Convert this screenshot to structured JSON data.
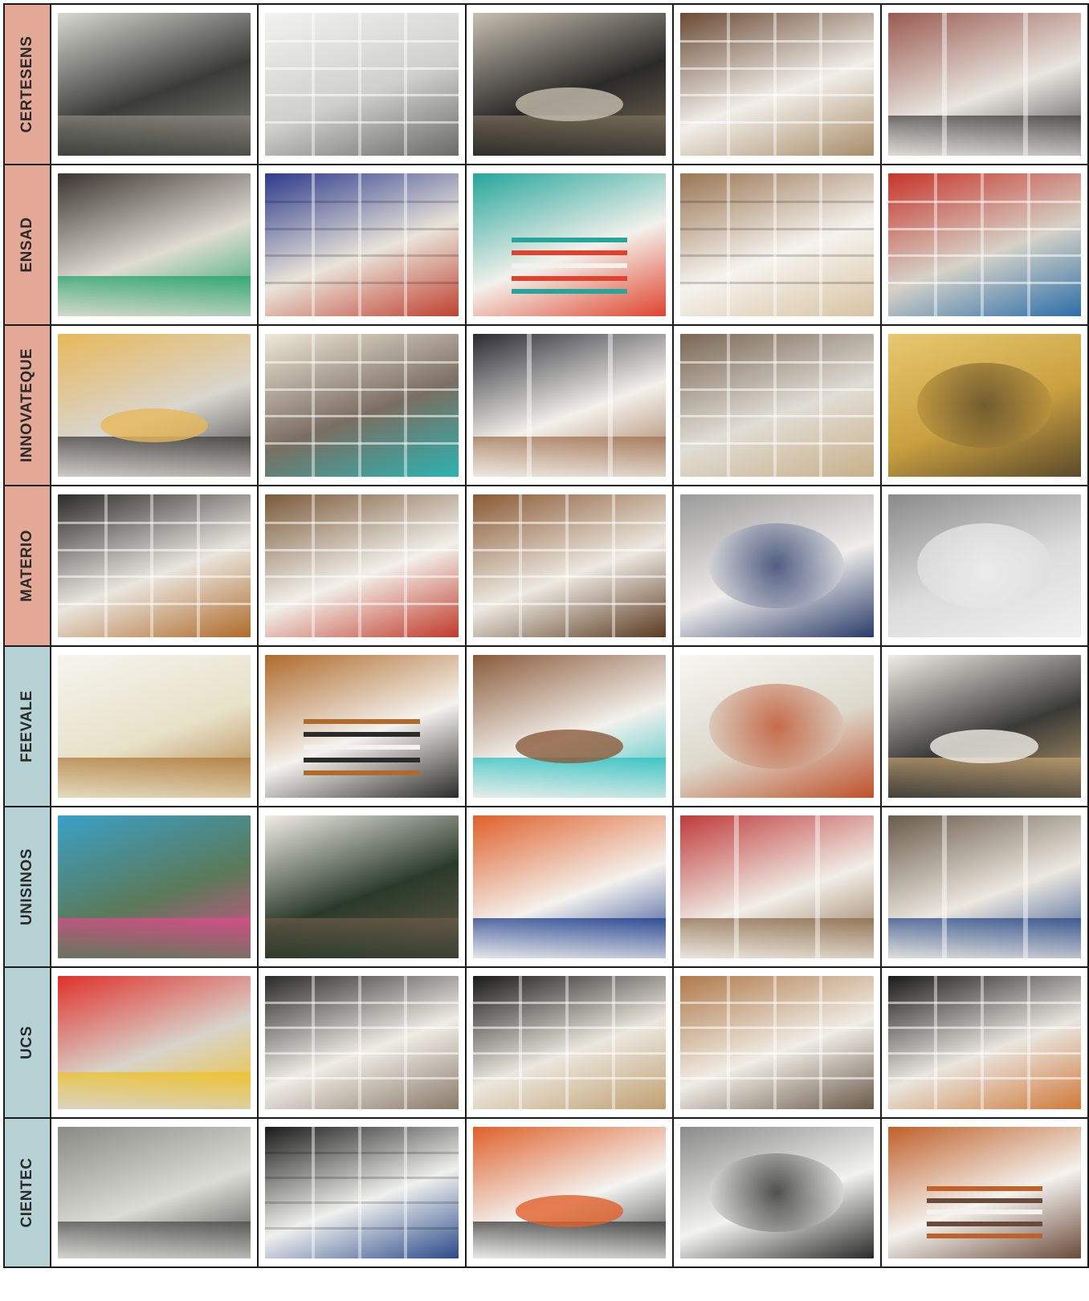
{
  "colors": {
    "salmon": "#e3a896",
    "teal": "#b7d2d4",
    "border": "#1a1a1a"
  },
  "rows": [
    {
      "label": "CERTESENS",
      "band": "salmon",
      "photos": [
        {
          "name": "reading-room",
          "tones": [
            "#3b3b38",
            "#d8d8d2",
            "#8a8a80"
          ],
          "style": "room"
        },
        {
          "name": "wire-shelves",
          "tones": [
            "#cfcfcb",
            "#f2f2ee",
            "#6a6a66"
          ],
          "style": "shelves"
        },
        {
          "name": "sample-table",
          "tones": [
            "#2a2a28",
            "#c7bfb0",
            "#7d6f5d"
          ],
          "style": "table"
        },
        {
          "name": "leather-shelves",
          "tones": [
            "#f1efea",
            "#6b4a34",
            "#a88c6a"
          ],
          "style": "shelves"
        },
        {
          "name": "library-aisle",
          "tones": [
            "#e8e6e0",
            "#9a5a50",
            "#444"
          ],
          "style": "aisle"
        }
      ]
    },
    {
      "label": "ENSAD",
      "band": "salmon",
      "photos": [
        {
          "name": "workroom",
          "tones": [
            "#e0dcd2",
            "#3a3430",
            "#1fa26a"
          ],
          "style": "room"
        },
        {
          "name": "fabric-rack",
          "tones": [
            "#e9e4da",
            "#2d3a8c",
            "#c04030"
          ],
          "style": "rack"
        },
        {
          "name": "color-plates",
          "tones": [
            "#f3f1ec",
            "#26a69a",
            "#e0432d"
          ],
          "style": "stack"
        },
        {
          "name": "leather-samples",
          "tones": [
            "#f5f3ef",
            "#9a7654",
            "#d8c3a3"
          ],
          "style": "rack"
        },
        {
          "name": "yarn-shelves",
          "tones": [
            "#d6d2c8",
            "#c7352b",
            "#2b6ea8"
          ],
          "style": "shelves"
        }
      ]
    },
    {
      "label": "INNOVATEQUE",
      "band": "salmon",
      "photos": [
        {
          "name": "meeting-table",
          "tones": [
            "#d9d6cf",
            "#e7b85a",
            "#3c3c3c"
          ],
          "style": "table"
        },
        {
          "name": "library-wall",
          "tones": [
            "#7a6e62",
            "#efe7d8",
            "#2bb3b1"
          ],
          "style": "shelves"
        },
        {
          "name": "composite-aisle",
          "tones": [
            "#f3f1ec",
            "#2a2a32",
            "#a07050"
          ],
          "style": "aisle"
        },
        {
          "name": "sample-cabinet",
          "tones": [
            "#e0ddd5",
            "#7a6755",
            "#c8b08a"
          ],
          "style": "shelves"
        },
        {
          "name": "foam-sample",
          "tones": [
            "#caa040",
            "#e7c870",
            "#5b4a2a"
          ],
          "style": "object"
        }
      ]
    },
    {
      "label": "MATERIO",
      "band": "salmon",
      "photos": [
        {
          "name": "visitor-shelves",
          "tones": [
            "#e9e6df",
            "#2b2b2b",
            "#b06a2a"
          ],
          "style": "shelves"
        },
        {
          "name": "binder-shelf",
          "tones": [
            "#f2f0eb",
            "#7a5a3a",
            "#c03a2a"
          ],
          "style": "shelves"
        },
        {
          "name": "wood-samples",
          "tones": [
            "#ede9e2",
            "#8a5a34",
            "#5a3a20"
          ],
          "style": "shelves"
        },
        {
          "name": "metal-mesh",
          "tones": [
            "#efedea",
            "#9a9a9a",
            "#2b3b6a"
          ],
          "style": "object"
        },
        {
          "name": "metal-pillow",
          "tones": [
            "#dcdcdc",
            "#8a8a8a",
            "#f0f0f0"
          ],
          "style": "object"
        }
      ]
    },
    {
      "label": "FEEVALE",
      "band": "teal",
      "photos": [
        {
          "name": "display-room",
          "tones": [
            "#e7e1c8",
            "#f6f4ef",
            "#b07a3a"
          ],
          "style": "room"
        },
        {
          "name": "open-drawers",
          "tones": [
            "#f4f2ee",
            "#b06a2a",
            "#2b2b2b"
          ],
          "style": "stack"
        },
        {
          "name": "display-tray",
          "tones": [
            "#f3f1ed",
            "#8a5a3a",
            "#2bc0c0"
          ],
          "style": "table"
        },
        {
          "name": "display-unit",
          "tones": [
            "#dcd8cc",
            "#f8f6f2",
            "#c0502a"
          ],
          "style": "object"
        },
        {
          "name": "photo-table",
          "tones": [
            "#3a3a38",
            "#f0ede6",
            "#c0a070"
          ],
          "style": "table"
        }
      ]
    },
    {
      "label": "UNISINOS",
      "band": "teal",
      "photos": [
        {
          "name": "container-exterior",
          "tones": [
            "#5a7a5a",
            "#3aa0c8",
            "#e04a8a"
          ],
          "style": "room"
        },
        {
          "name": "container-event",
          "tones": [
            "#2a3a2a",
            "#f0ede6",
            "#6a5a4a"
          ],
          "style": "room"
        },
        {
          "name": "reception-desk",
          "tones": [
            "#f4f2ee",
            "#e0602a",
            "#1a3a8a"
          ],
          "style": "room"
        },
        {
          "name": "sample-corridor",
          "tones": [
            "#f1eee8",
            "#c03a3a",
            "#8a6a4a"
          ],
          "style": "aisle"
        },
        {
          "name": "visitors-corridor",
          "tones": [
            "#ece8e0",
            "#6a5a4a",
            "#2a4a8a"
          ],
          "style": "aisle"
        }
      ]
    },
    {
      "label": "UCS",
      "band": "teal",
      "photos": [
        {
          "name": "glass-entrance",
          "tones": [
            "#d8d4cc",
            "#e0302a",
            "#f0c020"
          ],
          "style": "room"
        },
        {
          "name": "panel-displays",
          "tones": [
            "#efece6",
            "#2a2a2a",
            "#8a7a6a"
          ],
          "style": "shelves"
        },
        {
          "name": "grid-panels",
          "tones": [
            "#ebe7df",
            "#1a1a1a",
            "#c0a070"
          ],
          "style": "shelves"
        },
        {
          "name": "cubby-shelves",
          "tones": [
            "#f0ede6",
            "#b07a4a",
            "#6a5a4a"
          ],
          "style": "shelves"
        },
        {
          "name": "sample-grid",
          "tones": [
            "#e9e6e0",
            "#1a1a1a",
            "#d07a3a"
          ],
          "style": "shelves"
        }
      ]
    },
    {
      "label": "CIENTEC",
      "band": "teal",
      "photos": [
        {
          "name": "office-room",
          "tones": [
            "#dcdcd6",
            "#8a8a84",
            "#4a4a48"
          ],
          "style": "room"
        },
        {
          "name": "sample-boards",
          "tones": [
            "#f0f0ee",
            "#1a1a1a",
            "#2a4a8a"
          ],
          "style": "rack"
        },
        {
          "name": "swatch-spread",
          "tones": [
            "#f4f4f2",
            "#e0602a",
            "#3a3a3a"
          ],
          "style": "table"
        },
        {
          "name": "faucet-display",
          "tones": [
            "#f2f2f0",
            "#8a8a8a",
            "#2a2a2a"
          ],
          "style": "object"
        },
        {
          "name": "tile-stand",
          "tones": [
            "#f4f2ee",
            "#c0602a",
            "#6a4a3a"
          ],
          "style": "stack"
        }
      ]
    }
  ]
}
